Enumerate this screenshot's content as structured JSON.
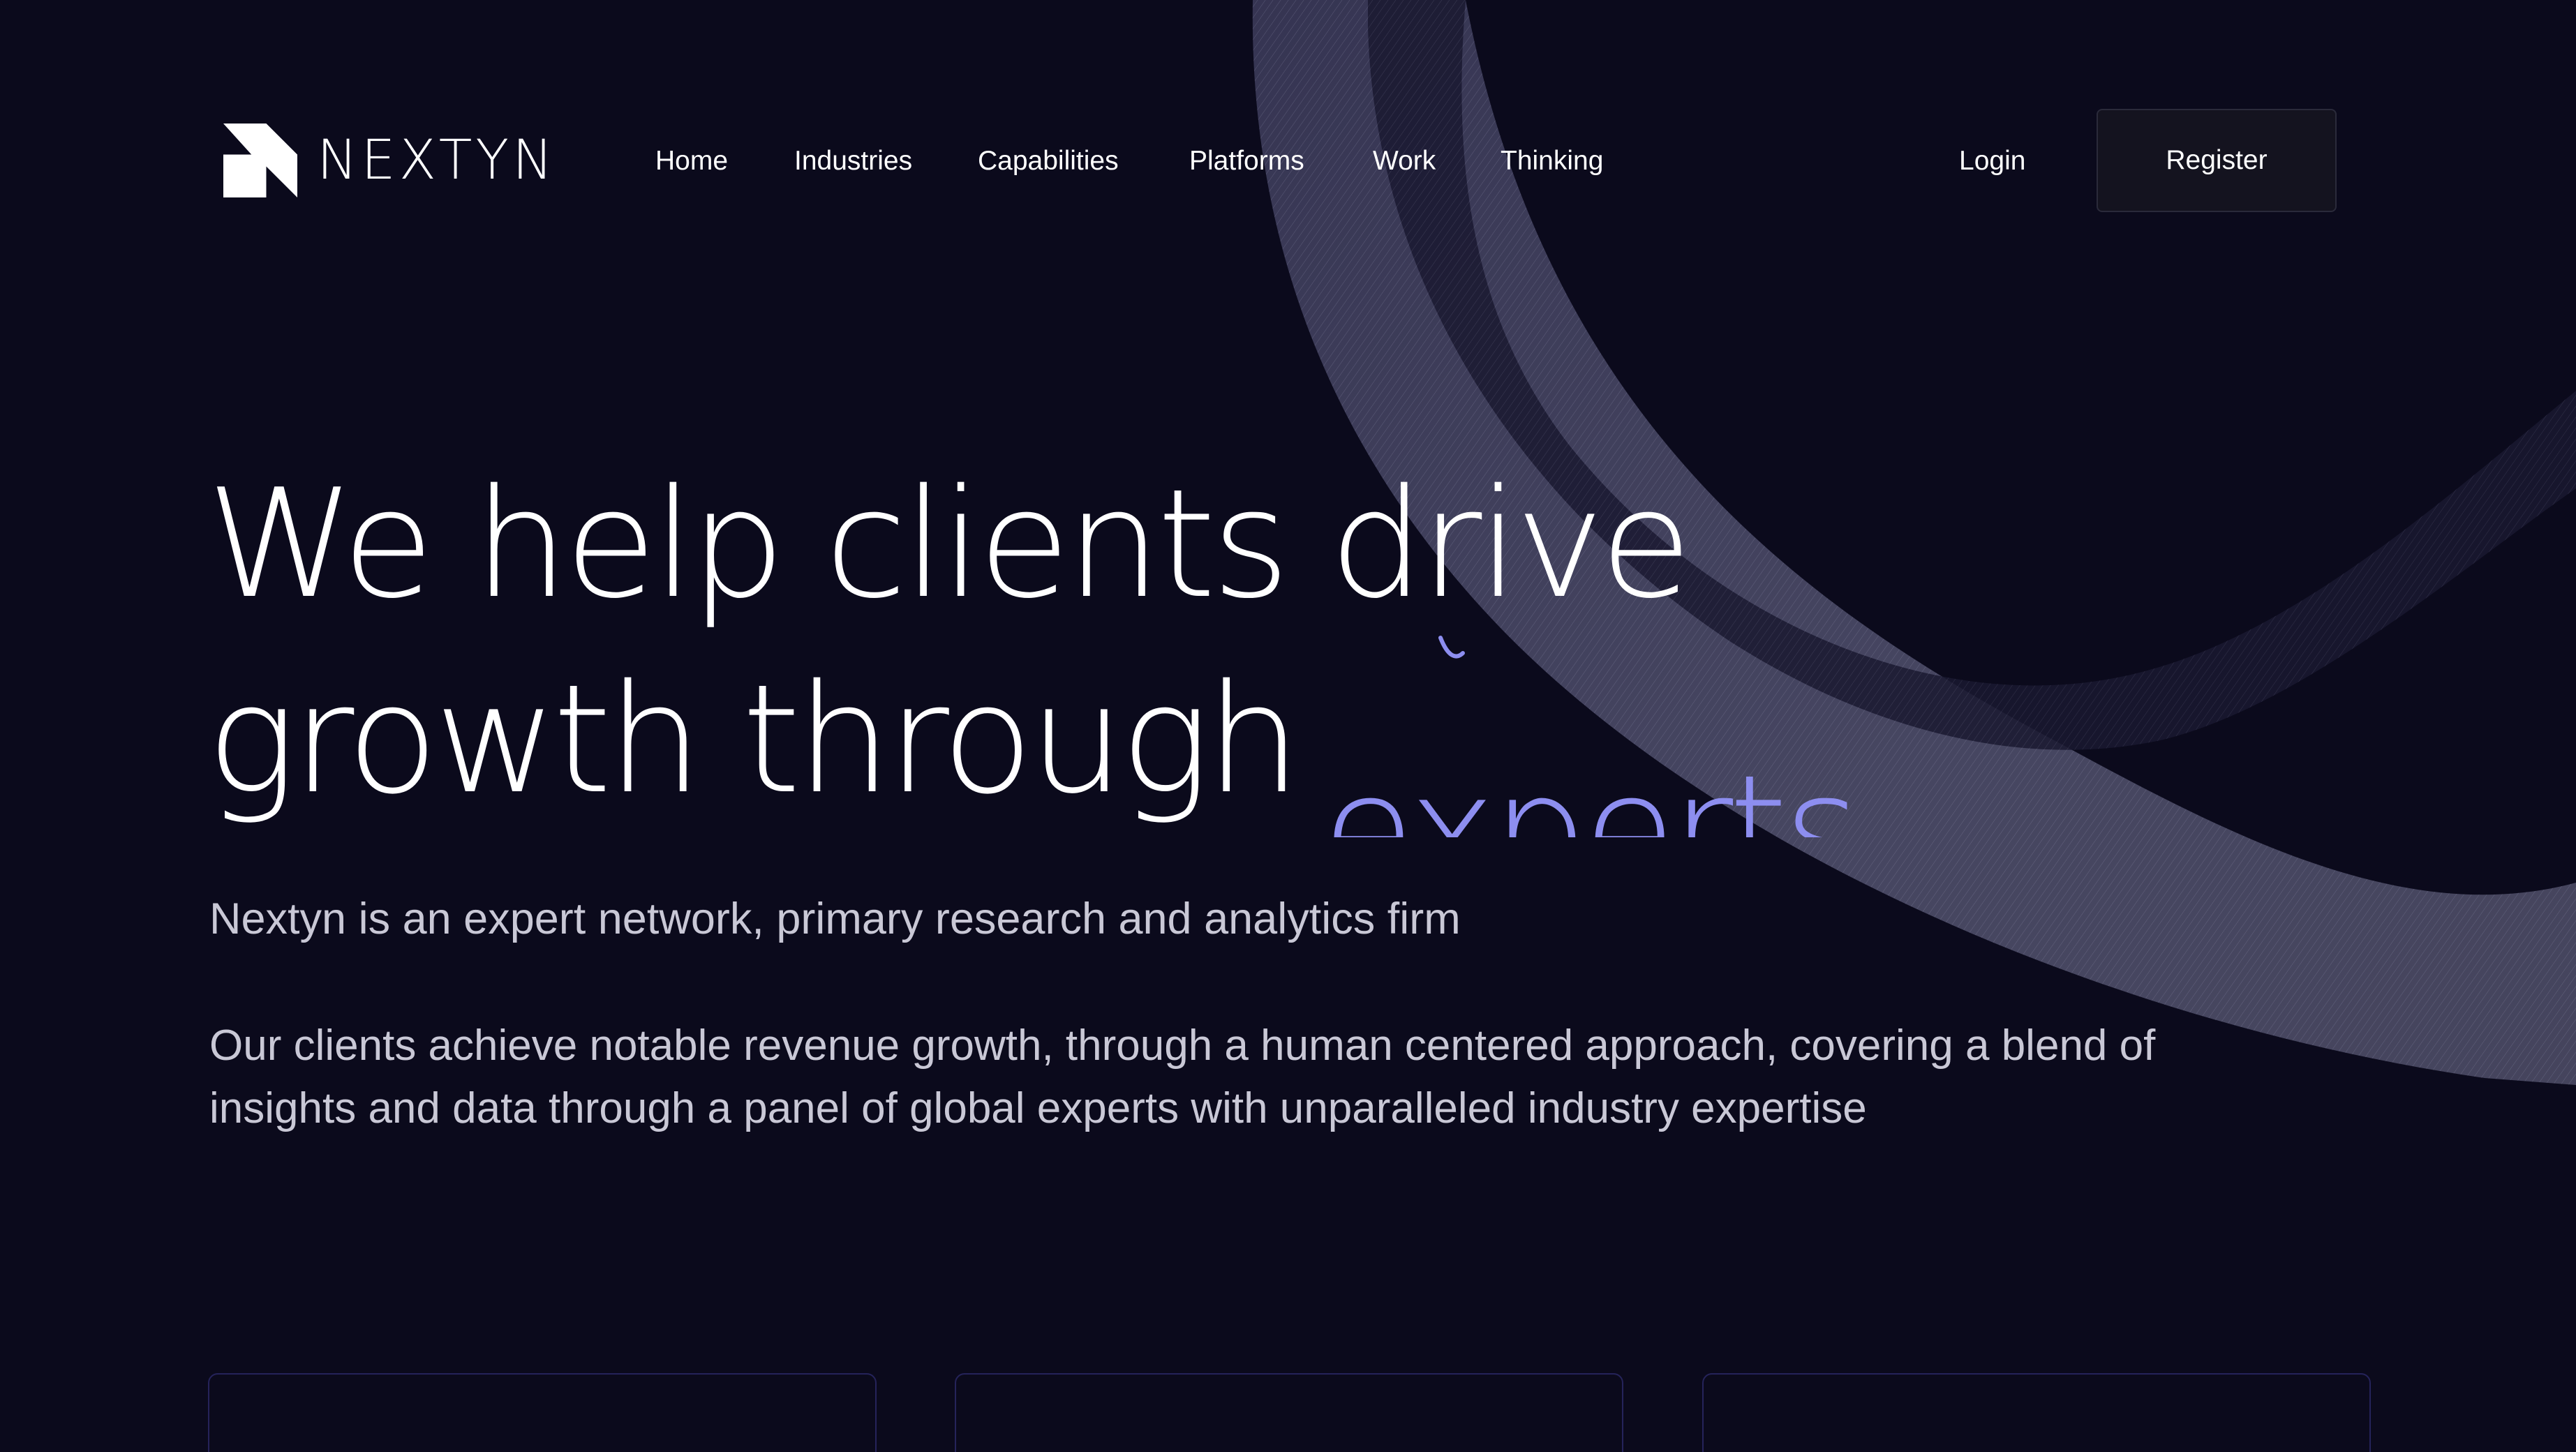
{
  "brand": {
    "name": "NEXTYN",
    "logo_icon": "nextyn-logo-mark"
  },
  "nav": {
    "items": [
      {
        "label": "Home"
      },
      {
        "label": "Industries"
      },
      {
        "label": "Capabilities"
      },
      {
        "label": "Platforms"
      },
      {
        "label": "Work"
      },
      {
        "label": "Thinking"
      }
    ],
    "login_label": "Login",
    "register_label": "Register"
  },
  "hero": {
    "title_line_1": "We help clients drive",
    "title_line_2": "growth through",
    "rotating_word": "experts",
    "subtitle": "Nextyn is an expert network, primary research and analytics firm",
    "description": "Our clients achieve notable revenue growth, through a human centered approach, covering a blend of insights and data through a panel of global experts with unparalleled industry expertise"
  },
  "cards": [
    {
      "icon": "card-icon-1"
    },
    {
      "icon": "card-icon-2"
    },
    {
      "icon": "card-icon-3"
    }
  ],
  "colors": {
    "background": "#0b0a1c",
    "text_primary": "#ffffff",
    "text_secondary": "#c9c8d6",
    "accent": "#8d8ef0",
    "card_border": "#25235a",
    "ribbon": "#5a5a78"
  }
}
